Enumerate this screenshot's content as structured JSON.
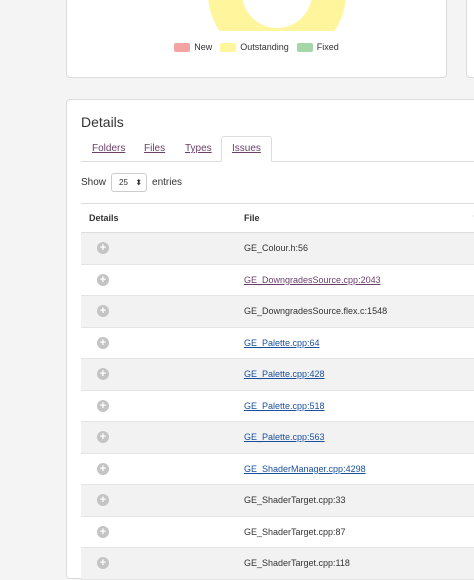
{
  "legend": {
    "items": [
      {
        "label": "New",
        "color": "#f4a3a3"
      },
      {
        "label": "Outstanding",
        "color": "#fff59d"
      },
      {
        "label": "Fixed",
        "color": "#a5d6a7"
      }
    ]
  },
  "details": {
    "title": "Details",
    "tabs": [
      {
        "label": "Folders"
      },
      {
        "label": "Files"
      },
      {
        "label": "Types"
      },
      {
        "label": "Issues"
      }
    ],
    "show_label": "Show",
    "entries_value": "25",
    "entries_label": "entries",
    "table": {
      "col_details": "Details",
      "col_file": "File",
      "sort_icon": "↑↓",
      "rows": [
        {
          "file": "GE_Colour.h:56",
          "style": "plain"
        },
        {
          "file": "GE_DowngradesSource.cpp:2043",
          "style": "visited"
        },
        {
          "file": "GE_DowngradesSource.flex.c:1548",
          "style": "plain"
        },
        {
          "file": "GE_Palette.cpp:64",
          "style": "link"
        },
        {
          "file": "GE_Palette.cpp:428",
          "style": "link"
        },
        {
          "file": "GE_Palette.cpp:518",
          "style": "link"
        },
        {
          "file": "GE_Palette.cpp:563",
          "style": "link"
        },
        {
          "file": "GE_ShaderManager.cpp:4298",
          "style": "link"
        },
        {
          "file": "GE_ShaderTarget.cpp:33",
          "style": "plain"
        },
        {
          "file": "GE_ShaderTarget.cpp:87",
          "style": "plain"
        },
        {
          "file": "GE_ShaderTarget.cpp:118",
          "style": "plain"
        }
      ]
    }
  }
}
